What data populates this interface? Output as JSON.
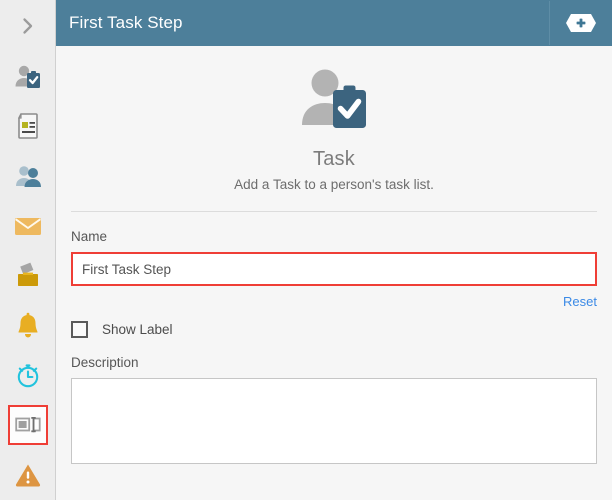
{
  "header": {
    "title": "First Task Step",
    "add_icon": "plus-badge-icon",
    "background": "#4d7f9a"
  },
  "sidebar": {
    "collapse_icon": "chevron-right-icon",
    "items": [
      {
        "icon": "person-task-clipboard-icon",
        "selected": false
      },
      {
        "icon": "document-form-icon",
        "selected": false
      },
      {
        "icon": "two-people-icon",
        "selected": false
      },
      {
        "icon": "envelope-mail-icon",
        "selected": false
      },
      {
        "icon": "ballot-box-icon",
        "selected": false
      },
      {
        "icon": "bell-notification-icon",
        "selected": false
      },
      {
        "icon": "stopwatch-timer-icon",
        "selected": false
      },
      {
        "icon": "form-panel-icon",
        "selected": true
      },
      {
        "icon": "warning-triangle-icon",
        "selected": false
      }
    ],
    "selection_color": "#ef3e36"
  },
  "hero": {
    "icon": "person-task-clipboard-icon",
    "title": "Task",
    "subtitle": "Add a Task to a person's task list."
  },
  "form": {
    "name_label": "Name",
    "name_value": "First Task Step",
    "name_placeholder": "",
    "name_border_color": "#ef3e36",
    "reset_label": "Reset",
    "reset_color": "#3b8ae6",
    "show_label_text": "Show Label",
    "show_label_checked": false,
    "description_label": "Description",
    "description_value": "",
    "description_placeholder": ""
  }
}
